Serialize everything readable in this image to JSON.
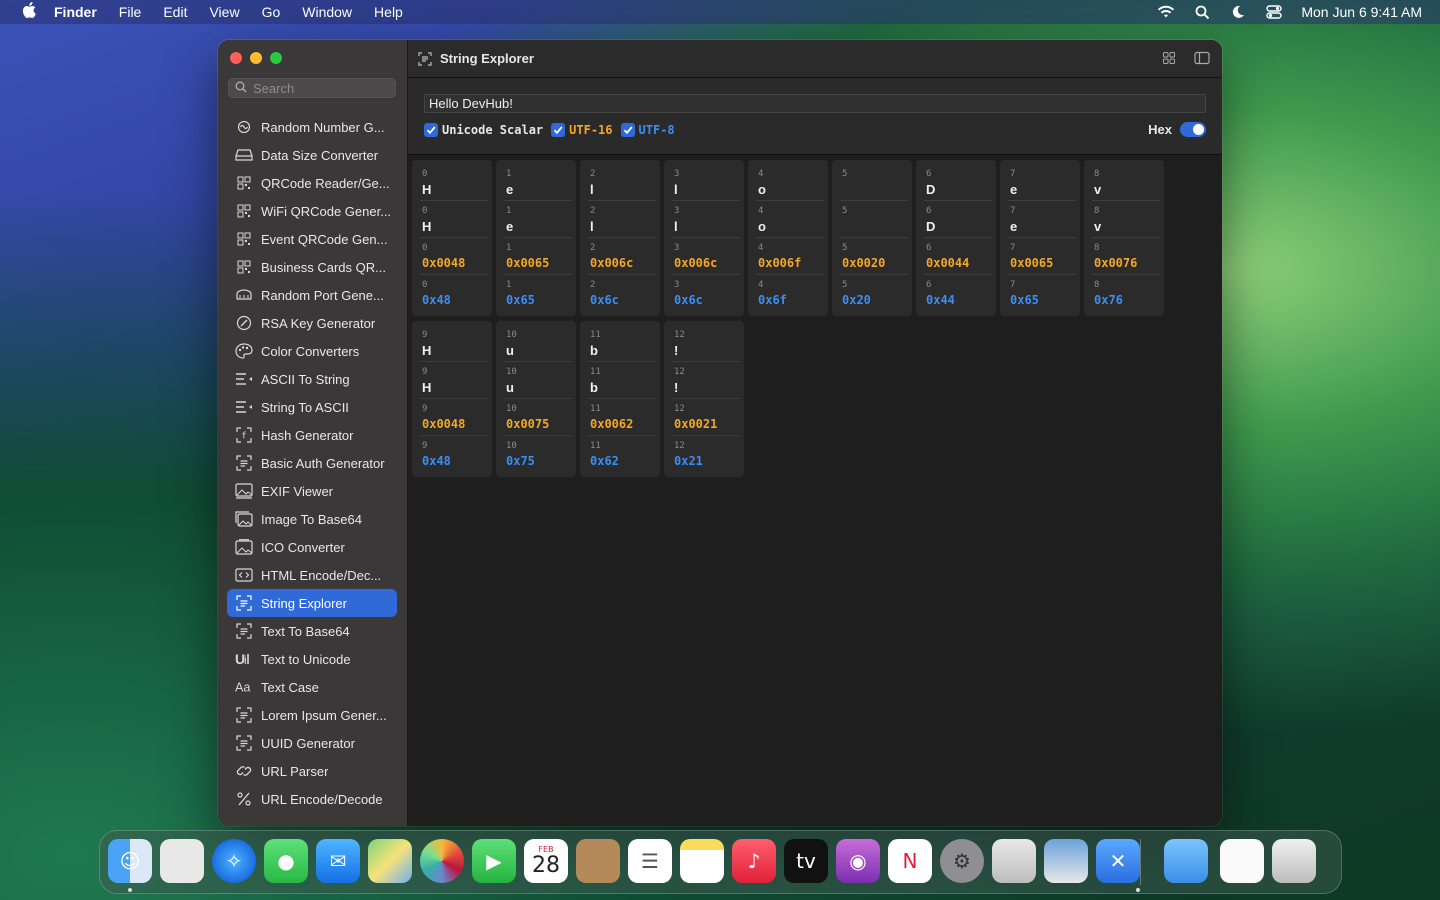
{
  "menubar": {
    "app": "Finder",
    "items": [
      "File",
      "Edit",
      "View",
      "Go",
      "Window",
      "Help"
    ],
    "datetime": "Mon Jun 6  9:41 AM"
  },
  "search": {
    "placeholder": "Search"
  },
  "sidebar": {
    "items": [
      {
        "label": "Random Number G...",
        "icon": "infinity-icon"
      },
      {
        "label": "Data Size Converter",
        "icon": "drive-icon"
      },
      {
        "label": "QRCode Reader/Ge...",
        "icon": "qrcode-icon"
      },
      {
        "label": "WiFi QRCode Gener...",
        "icon": "qrcode-icon"
      },
      {
        "label": "Event QRCode Gen...",
        "icon": "qrcode-icon"
      },
      {
        "label": "Business Cards QR...",
        "icon": "qrcode-icon"
      },
      {
        "label": "Random Port Gene...",
        "icon": "port-icon"
      },
      {
        "label": "RSA Key Generator",
        "icon": "signature-icon"
      },
      {
        "label": "Color Converters",
        "icon": "palette-icon"
      },
      {
        "label": "ASCII To String",
        "icon": "list-arrow-icon"
      },
      {
        "label": "String To ASCII",
        "icon": "list-arrow-icon"
      },
      {
        "label": "Hash Generator",
        "icon": "brackets-icon"
      },
      {
        "label": "Basic Auth Generator",
        "icon": "text-viewfinder-icon"
      },
      {
        "label": "EXIF Viewer",
        "icon": "photo-icon"
      },
      {
        "label": "Image To Base64",
        "icon": "photo-stack-icon"
      },
      {
        "label": "ICO Converter",
        "icon": "photo-frame-icon"
      },
      {
        "label": "HTML Encode/Dec...",
        "icon": "code-icon"
      },
      {
        "label": "String Explorer",
        "icon": "text-viewfinder-icon"
      },
      {
        "label": "Text To Base64",
        "icon": "text-viewfinder-icon"
      },
      {
        "label": "Text to Unicode",
        "icon": "unicode-icon"
      },
      {
        "label": "Text Case",
        "icon": "textformat-icon"
      },
      {
        "label": "Lorem Ipsum Gener...",
        "icon": "text-viewfinder-icon"
      },
      {
        "label": "UUID Generator",
        "icon": "text-viewfinder-icon"
      },
      {
        "label": "URL Parser",
        "icon": "link-icon"
      },
      {
        "label": "URL Encode/Decode",
        "icon": "percent-icon"
      }
    ],
    "active_index": 17
  },
  "main": {
    "title": "String Explorer",
    "input_value": "Hello DevHub!",
    "options": {
      "unicode_scalar": "Unicode Scalar",
      "utf16": "UTF-16",
      "utf8": "UTF-8",
      "hex": "Hex"
    },
    "colors": {
      "utf16": "#f5a623",
      "utf8": "#3a8ef6",
      "accent": "#2f6ad8"
    },
    "chars": [
      {
        "i": "0",
        "scalar": "H",
        "u16": "H",
        "u16hex": "0x0048",
        "u8hex": "0x48"
      },
      {
        "i": "1",
        "scalar": "e",
        "u16": "e",
        "u16hex": "0x0065",
        "u8hex": "0x65"
      },
      {
        "i": "2",
        "scalar": "l",
        "u16": "l",
        "u16hex": "0x006c",
        "u8hex": "0x6c"
      },
      {
        "i": "3",
        "scalar": "l",
        "u16": "l",
        "u16hex": "0x006c",
        "u8hex": "0x6c"
      },
      {
        "i": "4",
        "scalar": "o",
        "u16": "o",
        "u16hex": "0x006f",
        "u8hex": "0x6f"
      },
      {
        "i": "5",
        "scalar": " ",
        "u16": " ",
        "u16hex": "0x0020",
        "u8hex": "0x20"
      },
      {
        "i": "6",
        "scalar": "D",
        "u16": "D",
        "u16hex": "0x0044",
        "u8hex": "0x44"
      },
      {
        "i": "7",
        "scalar": "e",
        "u16": "e",
        "u16hex": "0x0065",
        "u8hex": "0x65"
      },
      {
        "i": "8",
        "scalar": "v",
        "u16": "v",
        "u16hex": "0x0076",
        "u8hex": "0x76"
      },
      {
        "i": "9",
        "scalar": "H",
        "u16": "H",
        "u16hex": "0x0048",
        "u8hex": "0x48"
      },
      {
        "i": "10",
        "scalar": "u",
        "u16": "u",
        "u16hex": "0x0075",
        "u8hex": "0x75"
      },
      {
        "i": "11",
        "scalar": "b",
        "u16": "b",
        "u16hex": "0x0062",
        "u8hex": "0x62"
      },
      {
        "i": "12",
        "scalar": "!",
        "u16": "!",
        "u16hex": "0x0021",
        "u8hex": "0x21"
      }
    ]
  },
  "dock": {
    "calendar_month": "FEB",
    "calendar_day": "28",
    "apps": [
      "finder-icon",
      "launchpad-icon",
      "safari-icon",
      "messages-icon",
      "mail-icon",
      "maps-icon",
      "photos-icon",
      "facetime-icon",
      "calendar-icon",
      "contacts-icon",
      "reminders-icon",
      "notes-icon",
      "music-icon",
      "tv-icon",
      "podcasts-icon",
      "news-icon",
      "settings-icon",
      "script-editor-icon",
      "preview-icon",
      "devhub-icon",
      "folder-icon",
      "document-icon",
      "trash-icon"
    ]
  }
}
